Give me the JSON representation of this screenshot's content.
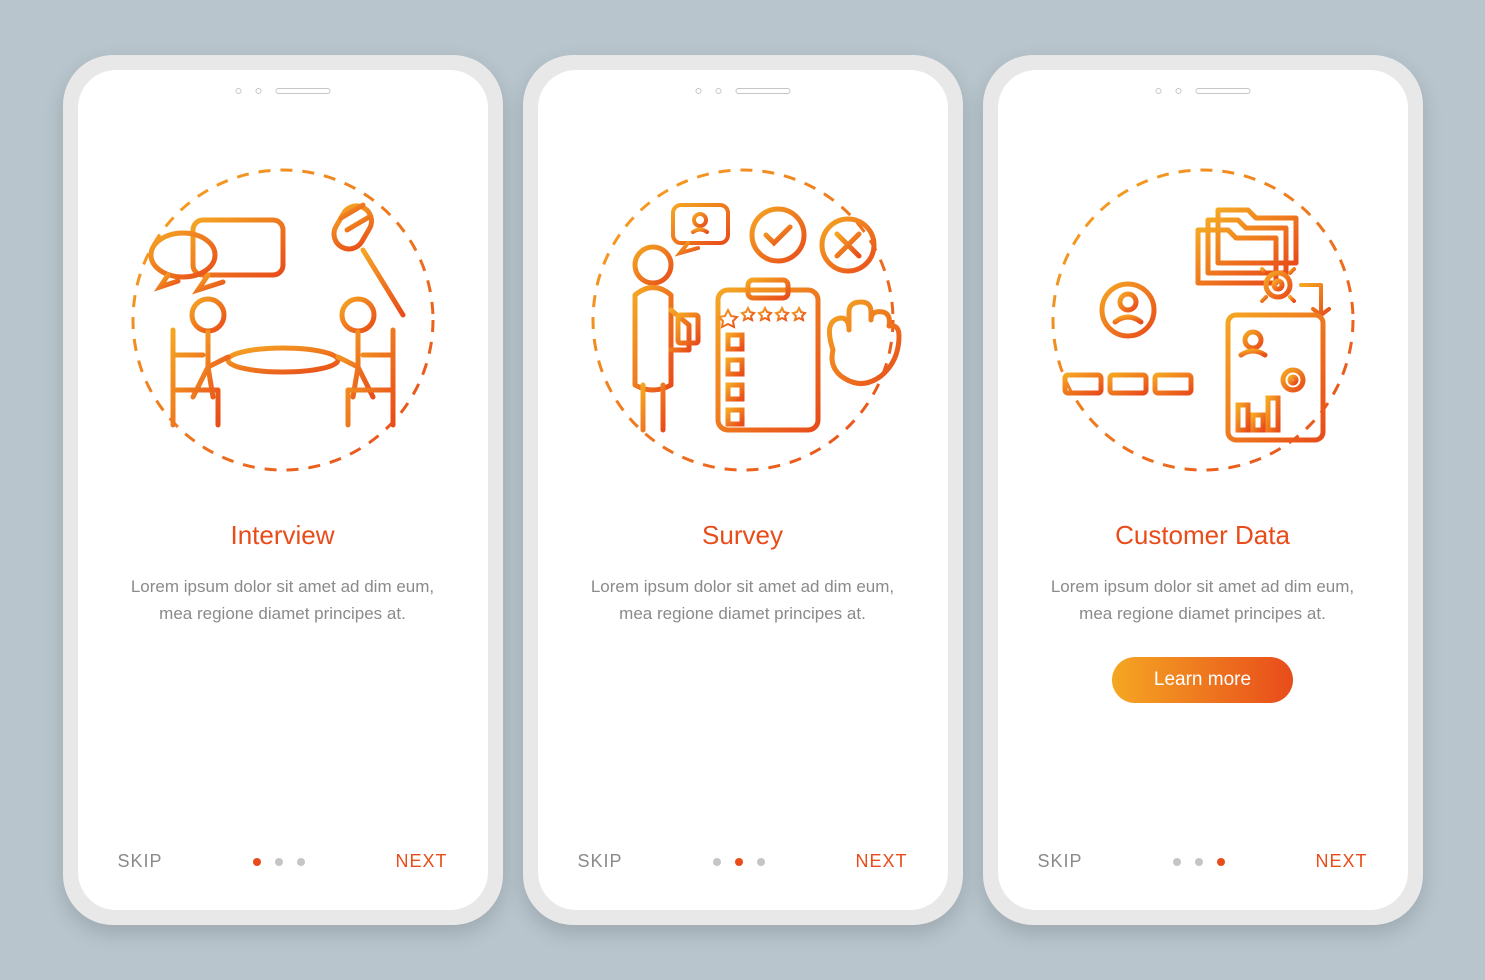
{
  "screens": [
    {
      "title": "Interview",
      "description": "Lorem ipsum dolor sit amet ad dim eum, mea regione diamet principes at.",
      "skip_label": "SKIP",
      "next_label": "NEXT",
      "active_dot": 0,
      "has_cta": false,
      "illustration": "interview-icon"
    },
    {
      "title": "Survey",
      "description": "Lorem ipsum dolor sit amet ad dim eum, mea regione diamet principes at.",
      "skip_label": "SKIP",
      "next_label": "NEXT",
      "active_dot": 1,
      "has_cta": false,
      "illustration": "survey-icon"
    },
    {
      "title": "Customer Data",
      "description": "Lorem ipsum dolor sit amet ad dim eum, mea regione diamet principes at.",
      "skip_label": "SKIP",
      "next_label": "NEXT",
      "active_dot": 2,
      "has_cta": true,
      "cta_label": "Learn more",
      "illustration": "customer-data-icon"
    }
  ],
  "colors": {
    "accent_start": "#f5a623",
    "accent_end": "#e84c1a",
    "text_muted": "#8a8a8a",
    "background": "#b8c5cd"
  }
}
